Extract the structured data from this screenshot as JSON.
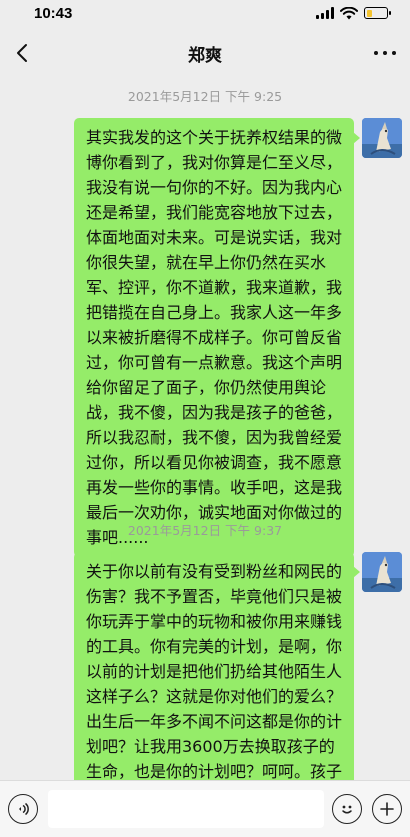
{
  "status_bar": {
    "time": "10:43",
    "battery_level": 0.3
  },
  "nav": {
    "title": "郑爽",
    "back_icon": "chevron-left-icon",
    "more_icon": "more-dots-icon"
  },
  "messages": [
    {
      "timestamp": "2021年5月12日 下午 9:25",
      "text": "其实我发的这个关于抚养权结果的微博你看到了，我对你算是仁至义尽，我没有说一句你的不好。因为我内心还是希望，我们能宽容地放下过去，体面地面对未来。可是说实话，我对你很失望，就在早上你仍然在买水军、控评，你不道歉，我来道歉，我把错揽在自己身上。我家人这一年多以来被折磨得不成样子。你可曾反省过，你可曾有一点歉意。我这个声明给你留足了面子，你仍然使用舆论战，我不傻，因为我是孩子的爸爸，所以我忍耐，我不傻，因为我曾经爱过你，所以看见你被调查，我不愿意再发一些你的事情。收手吧，这是我最后一次劝你，诚实地面对你做过的事吧......"
    },
    {
      "timestamp": "2021年5月12日 下午 9:37",
      "text": "关于你以前有没有受到粉丝和网民的伤害？我不予置否，毕竟他们只是被你玩弄于掌中的玩物和被你用来赚钱的工具。你有完美的计划，是啊，你以前的计划是把他们扔给其他陌生人这样子么？这就是你对他们的爱么？出生后一年多不闻不问这都是你的计划吧？让我用3600万去换取孩子的生命，也是你的计划吧？呵呵。孩子不能回国这一切都是都是你周密计划的一部分？如"
    }
  ],
  "input_bar": {
    "voice_icon": "voice-icon",
    "emoji_icon": "emoji-icon",
    "plus_icon": "plus-icon"
  },
  "colors": {
    "background": "#ededed",
    "bubble": "#95ec69",
    "timestamp": "#9a9a9a"
  }
}
